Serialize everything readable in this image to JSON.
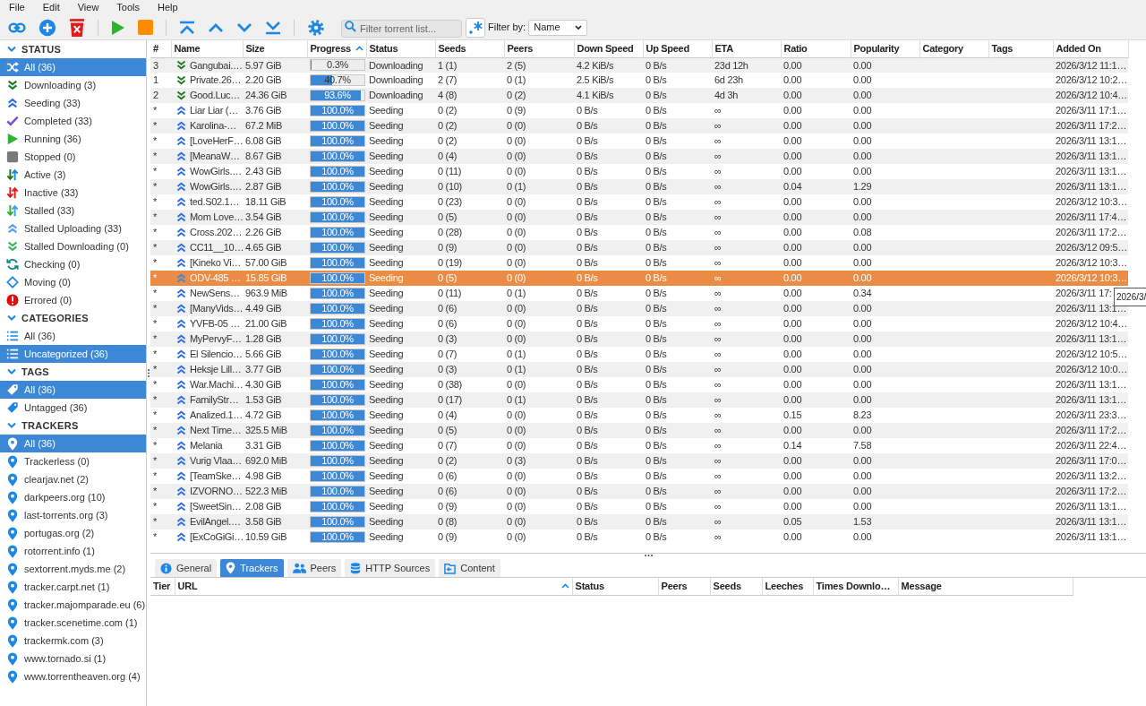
{
  "menu": [
    "File",
    "Edit",
    "View",
    "Tools",
    "Help"
  ],
  "toolbar": {
    "search": {
      "placeholder": "Filter torrent list..."
    },
    "filter_label": "Filter by:",
    "filter_value": "Name"
  },
  "sidebar": [
    {
      "title": "STATUS",
      "expanded": true,
      "kind": "status",
      "items": [
        {
          "label": "All (36)",
          "selected": true,
          "kind": "all"
        },
        {
          "label": "Downloading (3)",
          "selected": false,
          "kind": "downloading"
        },
        {
          "label": "Seeding (33)",
          "selected": false,
          "kind": "seeding"
        },
        {
          "label": "Completed (33)",
          "selected": false,
          "kind": "completed"
        },
        {
          "label": "Running (36)",
          "selected": false,
          "kind": "running"
        },
        {
          "label": "Stopped (0)",
          "selected": false,
          "kind": "stopped"
        },
        {
          "label": "Active (3)",
          "selected": false,
          "kind": "active"
        },
        {
          "label": "Inactive (33)",
          "selected": false,
          "kind": "inactive"
        },
        {
          "label": "Stalled (33)",
          "selected": false,
          "kind": "stalled"
        },
        {
          "label": "Stalled Uploading (33)",
          "selected": false,
          "kind": "stalled_up"
        },
        {
          "label": "Stalled Downloading (0)",
          "selected": false,
          "kind": "stalled_down"
        },
        {
          "label": "Checking (0)",
          "selected": false,
          "kind": "checking"
        },
        {
          "label": "Moving (0)",
          "selected": false,
          "kind": "moving"
        },
        {
          "label": "Errored (0)",
          "selected": false,
          "kind": "errored"
        }
      ]
    },
    {
      "title": "CATEGORIES",
      "expanded": true,
      "kind": "categories",
      "items": [
        {
          "label": "All (36)",
          "selected": false
        },
        {
          "label": "Uncategorized (36)",
          "selected": true
        }
      ]
    },
    {
      "title": "TAGS",
      "expanded": true,
      "kind": "tags",
      "items": [
        {
          "label": "All (36)",
          "selected": true
        },
        {
          "label": "Untagged (36)",
          "selected": false
        }
      ]
    },
    {
      "title": "TRACKERS",
      "expanded": true,
      "kind": "trackers",
      "items": [
        {
          "label": "All (36)",
          "selected": true
        },
        {
          "label": "Trackerless (0)",
          "selected": false
        },
        {
          "label": "clearjav.net (2)",
          "selected": false
        },
        {
          "label": "darkpeers.org (10)",
          "selected": false
        },
        {
          "label": "last-torrents.org (3)",
          "selected": false
        },
        {
          "label": "portugas.org (2)",
          "selected": false
        },
        {
          "label": "rotorrent.info (1)",
          "selected": false
        },
        {
          "label": "sextorrent.myds.me (2)",
          "selected": false
        },
        {
          "label": "tracker.carpt.net (1)",
          "selected": false
        },
        {
          "label": "tracker.majomparade.eu (6)",
          "selected": false
        },
        {
          "label": "tracker.scenetime.com (1)",
          "selected": false
        },
        {
          "label": "trackermk.com (3)",
          "selected": false
        },
        {
          "label": "www.tornado.si (1)",
          "selected": false
        },
        {
          "label": "www.torrentheaven.org (4)",
          "selected": false
        }
      ]
    }
  ],
  "table": {
    "columns": [
      {
        "label": "#",
        "sorted": false
      },
      {
        "label": "Name",
        "sorted": false
      },
      {
        "label": "Size",
        "sorted": false
      },
      {
        "label": "Progress",
        "sorted": true
      },
      {
        "label": "Status",
        "sorted": false
      },
      {
        "label": "Seeds",
        "sorted": false
      },
      {
        "label": "Peers",
        "sorted": false
      },
      {
        "label": "Down Speed",
        "sorted": false
      },
      {
        "label": "Up Speed",
        "sorted": false
      },
      {
        "label": "ETA",
        "sorted": false
      },
      {
        "label": "Ratio",
        "sorted": false
      },
      {
        "label": "Popularity",
        "sorted": false
      },
      {
        "label": "Category",
        "sorted": false
      },
      {
        "label": "Tags",
        "sorted": false
      },
      {
        "label": "Added On",
        "sorted": false
      }
    ],
    "rows": [
      {
        "num": "3",
        "kind": "downloading",
        "name": "Gangubai.…",
        "size": "5.97 GiB",
        "progress": "0.3%",
        "level": 0.003,
        "status": "Downloading",
        "seeds": "1 (1)",
        "peers": "2 (5)",
        "down": "4.2 KiB/s",
        "up": "0 B/s",
        "eta": "23d 12h",
        "ratio": "0.00",
        "popularity": "0.00",
        "added": "2026/3/12 11:1…",
        "selected": false
      },
      {
        "num": "1",
        "kind": "downloading",
        "name": "Private.26…",
        "size": "2.20 GiB",
        "progress": "40.7%",
        "level": 0.407,
        "status": "Downloading",
        "seeds": "2 (7)",
        "peers": "0 (1)",
        "down": "2.5 KiB/s",
        "up": "0 B/s",
        "eta": "6d 23h",
        "ratio": "0.00",
        "popularity": "0.00",
        "added": "2026/3/12 10:2…",
        "selected": false
      },
      {
        "num": "2",
        "kind": "downloading",
        "name": "Good.Luc…",
        "size": "24.36 GiB",
        "progress": "93.6%",
        "level": 0.936,
        "status": "Downloading",
        "seeds": "4 (8)",
        "peers": "0 (2)",
        "down": "4.1 KiB/s",
        "up": "0 B/s",
        "eta": "4d 3h",
        "ratio": "0.00",
        "popularity": "0.00",
        "added": "2026/3/12 10:4…",
        "selected": false
      },
      {
        "num": "*",
        "kind": "seeding",
        "name": "Liar Liar (…",
        "size": "3.76 GiB",
        "progress": "100.0%",
        "level": 1,
        "status": "Seeding",
        "seeds": "0 (2)",
        "peers": "0 (9)",
        "down": "0 B/s",
        "up": "0 B/s",
        "eta": "∞",
        "ratio": "0.00",
        "popularity": "0.00",
        "added": "2026/3/11 17:1…",
        "selected": false
      },
      {
        "num": "*",
        "kind": "seeding",
        "name": "Karolina-…",
        "size": "67.2 MiB",
        "progress": "100.0%",
        "level": 1,
        "status": "Seeding",
        "seeds": "0 (2)",
        "peers": "0 (0)",
        "down": "0 B/s",
        "up": "0 B/s",
        "eta": "∞",
        "ratio": "0.00",
        "popularity": "0.00",
        "added": "2026/3/11 17:2…",
        "selected": false
      },
      {
        "num": "*",
        "kind": "seeding",
        "name": "[LoveHerF…",
        "size": "6.08 GiB",
        "progress": "100.0%",
        "level": 1,
        "status": "Seeding",
        "seeds": "0 (2)",
        "peers": "0 (0)",
        "down": "0 B/s",
        "up": "0 B/s",
        "eta": "∞",
        "ratio": "0.00",
        "popularity": "0.00",
        "added": "2026/3/11 13:1…",
        "selected": false
      },
      {
        "num": "*",
        "kind": "seeding",
        "name": "[MeanaW…",
        "size": "8.67 GiB",
        "progress": "100.0%",
        "level": 1,
        "status": "Seeding",
        "seeds": "0 (4)",
        "peers": "0 (0)",
        "down": "0 B/s",
        "up": "0 B/s",
        "eta": "∞",
        "ratio": "0.00",
        "popularity": "0.00",
        "added": "2026/3/11 13:1…",
        "selected": false
      },
      {
        "num": "*",
        "kind": "seeding",
        "name": "WowGirls.…",
        "size": "2.43 GiB",
        "progress": "100.0%",
        "level": 1,
        "status": "Seeding",
        "seeds": "0 (11)",
        "peers": "0 (0)",
        "down": "0 B/s",
        "up": "0 B/s",
        "eta": "∞",
        "ratio": "0.00",
        "popularity": "0.00",
        "added": "2026/3/11 13:1…",
        "selected": false
      },
      {
        "num": "*",
        "kind": "seeding",
        "name": "WowGirls.…",
        "size": "2.87 GiB",
        "progress": "100.0%",
        "level": 1,
        "status": "Seeding",
        "seeds": "0 (10)",
        "peers": "0 (1)",
        "down": "0 B/s",
        "up": "0 B/s",
        "eta": "∞",
        "ratio": "0.04",
        "popularity": "1.29",
        "added": "2026/3/11 13:1…",
        "selected": false
      },
      {
        "num": "*",
        "kind": "seeding",
        "name": "ted.S02.1…",
        "size": "18.11 GiB",
        "progress": "100.0%",
        "level": 1,
        "status": "Seeding",
        "seeds": "0 (23)",
        "peers": "0 (0)",
        "down": "0 B/s",
        "up": "0 B/s",
        "eta": "∞",
        "ratio": "0.00",
        "popularity": "0.00",
        "added": "2026/3/12 10:3…",
        "selected": false
      },
      {
        "num": "*",
        "kind": "seeding",
        "name": "Mom Love…",
        "size": "3.54 GiB",
        "progress": "100.0%",
        "level": 1,
        "status": "Seeding",
        "seeds": "0 (5)",
        "peers": "0 (0)",
        "down": "0 B/s",
        "up": "0 B/s",
        "eta": "∞",
        "ratio": "0.00",
        "popularity": "0.00",
        "added": "2026/3/11 17:4…",
        "selected": false
      },
      {
        "num": "*",
        "kind": "seeding",
        "name": "Cross.202…",
        "size": "2.26 GiB",
        "progress": "100.0%",
        "level": 1,
        "status": "Seeding",
        "seeds": "0 (28)",
        "peers": "0 (0)",
        "down": "0 B/s",
        "up": "0 B/s",
        "eta": "∞",
        "ratio": "0.00",
        "popularity": "0.08",
        "added": "2026/3/11 17:2…",
        "selected": false
      },
      {
        "num": "*",
        "kind": "seeding",
        "name": "CC11__10…",
        "size": "4.65 GiB",
        "progress": "100.0%",
        "level": 1,
        "status": "Seeding",
        "seeds": "0 (9)",
        "peers": "0 (0)",
        "down": "0 B/s",
        "up": "0 B/s",
        "eta": "∞",
        "ratio": "0.00",
        "popularity": "0.00",
        "added": "2026/3/12 09:5…",
        "selected": false
      },
      {
        "num": "*",
        "kind": "seeding",
        "name": "[Kineko Vi…",
        "size": "57.00 GiB",
        "progress": "100.0%",
        "level": 1,
        "status": "Seeding",
        "seeds": "0 (19)",
        "peers": "0 (0)",
        "down": "0 B/s",
        "up": "0 B/s",
        "eta": "∞",
        "ratio": "0.00",
        "popularity": "0.00",
        "added": "2026/3/12 10:3…",
        "selected": false
      },
      {
        "num": "*",
        "kind": "seeding",
        "name": "ODV-485 …",
        "size": "15.85 GiB",
        "progress": "100.0%",
        "level": 1,
        "status": "Seeding",
        "seeds": "0 (5)",
        "peers": "0 (0)",
        "down": "0 B/s",
        "up": "0 B/s",
        "eta": "∞",
        "ratio": "0.00",
        "popularity": "0.00",
        "added": "2026/3/12 10:3…",
        "selected": true
      },
      {
        "num": "*",
        "kind": "seeding",
        "name": "NewSens…",
        "size": "963.9 MiB",
        "progress": "100.0%",
        "level": 1,
        "status": "Seeding",
        "seeds": "0 (11)",
        "peers": "0 (1)",
        "down": "0 B/s",
        "up": "0 B/s",
        "eta": "∞",
        "ratio": "0.00",
        "popularity": "0.34",
        "added": "2026/3/11 17:",
        "selected": false
      },
      {
        "num": "*",
        "kind": "seeding",
        "name": "[ManyVids…",
        "size": "4.49 GiB",
        "progress": "100.0%",
        "level": 1,
        "status": "Seeding",
        "seeds": "0 (6)",
        "peers": "0 (0)",
        "down": "0 B/s",
        "up": "0 B/s",
        "eta": "∞",
        "ratio": "0.00",
        "popularity": "0.00",
        "added": "2026/3/11 13:1…",
        "selected": false
      },
      {
        "num": "*",
        "kind": "seeding",
        "name": "YVFB-05 …",
        "size": "21.00 GiB",
        "progress": "100.0%",
        "level": 1,
        "status": "Seeding",
        "seeds": "0 (6)",
        "peers": "0 (0)",
        "down": "0 B/s",
        "up": "0 B/s",
        "eta": "∞",
        "ratio": "0.00",
        "popularity": "0.00",
        "added": "2026/3/12 10:4…",
        "selected": false
      },
      {
        "num": "*",
        "kind": "seeding",
        "name": "MyPervyF…",
        "size": "1.28 GiB",
        "progress": "100.0%",
        "level": 1,
        "status": "Seeding",
        "seeds": "0 (3)",
        "peers": "0 (0)",
        "down": "0 B/s",
        "up": "0 B/s",
        "eta": "∞",
        "ratio": "0.00",
        "popularity": "0.00",
        "added": "2026/3/11 13:1…",
        "selected": false
      },
      {
        "num": "*",
        "kind": "seeding",
        "name": "El Silencio…",
        "size": "5.66 GiB",
        "progress": "100.0%",
        "level": 1,
        "status": "Seeding",
        "seeds": "0 (7)",
        "peers": "0 (1)",
        "down": "0 B/s",
        "up": "0 B/s",
        "eta": "∞",
        "ratio": "0.00",
        "popularity": "0.00",
        "added": "2026/3/12 10:5…",
        "selected": false
      },
      {
        "num": "*",
        "kind": "seeding",
        "name": "Heksje Lill…",
        "size": "3.77 GiB",
        "progress": "100.0%",
        "level": 1,
        "status": "Seeding",
        "seeds": "0 (3)",
        "peers": "0 (1)",
        "down": "0 B/s",
        "up": "0 B/s",
        "eta": "∞",
        "ratio": "0.00",
        "popularity": "0.00",
        "added": "2026/3/12 10:0…",
        "selected": false
      },
      {
        "num": "*",
        "kind": "seeding",
        "name": "War.Machi…",
        "size": "4.30 GiB",
        "progress": "100.0%",
        "level": 1,
        "status": "Seeding",
        "seeds": "0 (38)",
        "peers": "0 (0)",
        "down": "0 B/s",
        "up": "0 B/s",
        "eta": "∞",
        "ratio": "0.00",
        "popularity": "0.00",
        "added": "2026/3/11 13:1…",
        "selected": false
      },
      {
        "num": "*",
        "kind": "seeding",
        "name": "FamilyStr…",
        "size": "1.53 GiB",
        "progress": "100.0%",
        "level": 1,
        "status": "Seeding",
        "seeds": "0 (17)",
        "peers": "0 (1)",
        "down": "0 B/s",
        "up": "0 B/s",
        "eta": "∞",
        "ratio": "0.00",
        "popularity": "0.00",
        "added": "2026/3/11 13:1…",
        "selected": false
      },
      {
        "num": "*",
        "kind": "seeding",
        "name": "Analized.1…",
        "size": "4.72 GiB",
        "progress": "100.0%",
        "level": 1,
        "status": "Seeding",
        "seeds": "0 (4)",
        "peers": "0 (0)",
        "down": "0 B/s",
        "up": "0 B/s",
        "eta": "∞",
        "ratio": "0.15",
        "popularity": "8.23",
        "added": "2026/3/11 23:3…",
        "selected": false
      },
      {
        "num": "*",
        "kind": "seeding",
        "name": "Next Time…",
        "size": "325.5 MiB",
        "progress": "100.0%",
        "level": 1,
        "status": "Seeding",
        "seeds": "0 (5)",
        "peers": "0 (0)",
        "down": "0 B/s",
        "up": "0 B/s",
        "eta": "∞",
        "ratio": "0.00",
        "popularity": "0.00",
        "added": "2026/3/11 17:2…",
        "selected": false
      },
      {
        "num": "*",
        "kind": "seeding",
        "name": "Melania",
        "size": "3.31 GiB",
        "progress": "100.0%",
        "level": 1,
        "status": "Seeding",
        "seeds": "0 (7)",
        "peers": "0 (0)",
        "down": "0 B/s",
        "up": "0 B/s",
        "eta": "∞",
        "ratio": "0.14",
        "popularity": "7.58",
        "added": "2026/3/11 22:4…",
        "selected": false
      },
      {
        "num": "*",
        "kind": "seeding",
        "name": "Vurig Vlaa…",
        "size": "692.0 MiB",
        "progress": "100.0%",
        "level": 1,
        "status": "Seeding",
        "seeds": "0 (2)",
        "peers": "0 (3)",
        "down": "0 B/s",
        "up": "0 B/s",
        "eta": "∞",
        "ratio": "0.00",
        "popularity": "0.00",
        "added": "2026/3/11 17:0…",
        "selected": false
      },
      {
        "num": "*",
        "kind": "seeding",
        "name": "[TeamSke…",
        "size": "4.98 GiB",
        "progress": "100.0%",
        "level": 1,
        "status": "Seeding",
        "seeds": "0 (6)",
        "peers": "0 (0)",
        "down": "0 B/s",
        "up": "0 B/s",
        "eta": "∞",
        "ratio": "0.00",
        "popularity": "0.00",
        "added": "2026/3/11 13:2…",
        "selected": false
      },
      {
        "num": "*",
        "kind": "seeding",
        "name": "IZVORNO…",
        "size": "522.3 MiB",
        "progress": "100.0%",
        "level": 1,
        "status": "Seeding",
        "seeds": "0 (6)",
        "peers": "0 (0)",
        "down": "0 B/s",
        "up": "0 B/s",
        "eta": "∞",
        "ratio": "0.00",
        "popularity": "0.00",
        "added": "2026/3/11 17:2…",
        "selected": false
      },
      {
        "num": "*",
        "kind": "seeding",
        "name": "[SweetSin…",
        "size": "2.08 GiB",
        "progress": "100.0%",
        "level": 1,
        "status": "Seeding",
        "seeds": "0 (9)",
        "peers": "0 (0)",
        "down": "0 B/s",
        "up": "0 B/s",
        "eta": "∞",
        "ratio": "0.00",
        "popularity": "0.00",
        "added": "2026/3/11 13:1…",
        "selected": false
      },
      {
        "num": "*",
        "kind": "seeding",
        "name": "EvilAngel.…",
        "size": "3.58 GiB",
        "progress": "100.0%",
        "level": 1,
        "status": "Seeding",
        "seeds": "0 (8)",
        "peers": "0 (0)",
        "down": "0 B/s",
        "up": "0 B/s",
        "eta": "∞",
        "ratio": "0.05",
        "popularity": "1.53",
        "added": "2026/3/11 13:1…",
        "selected": false
      },
      {
        "num": "*",
        "kind": "seeding",
        "name": "[ExCoGiGi…",
        "size": "10.59 GiB",
        "progress": "100.0%",
        "level": 1,
        "status": "Seeding",
        "seeds": "0 (9)",
        "peers": "0 (0)",
        "down": "0 B/s",
        "up": "0 B/s",
        "eta": "∞",
        "ratio": "0.00",
        "popularity": "0.00",
        "added": "2026/3/11 13:1…",
        "selected": false
      }
    ]
  },
  "tooltip": "2026/3/",
  "detail_tabs": [
    {
      "label": "General",
      "selected": false
    },
    {
      "label": "Trackers",
      "selected": true
    },
    {
      "label": "Peers",
      "selected": false
    },
    {
      "label": "HTTP Sources",
      "selected": false
    },
    {
      "label": "Content",
      "selected": false
    }
  ],
  "trackers_table": {
    "columns": [
      {
        "label": "Tier",
        "sorted": false
      },
      {
        "label": "URL",
        "sorted": true
      },
      {
        "label": "Status",
        "sorted": false
      },
      {
        "label": "Peers",
        "sorted": false
      },
      {
        "label": "Seeds",
        "sorted": false
      },
      {
        "label": "Leeches",
        "sorted": false
      },
      {
        "label": "Times Downlo…",
        "sorted": false
      },
      {
        "label": "Message",
        "sorted": false
      }
    ]
  }
}
